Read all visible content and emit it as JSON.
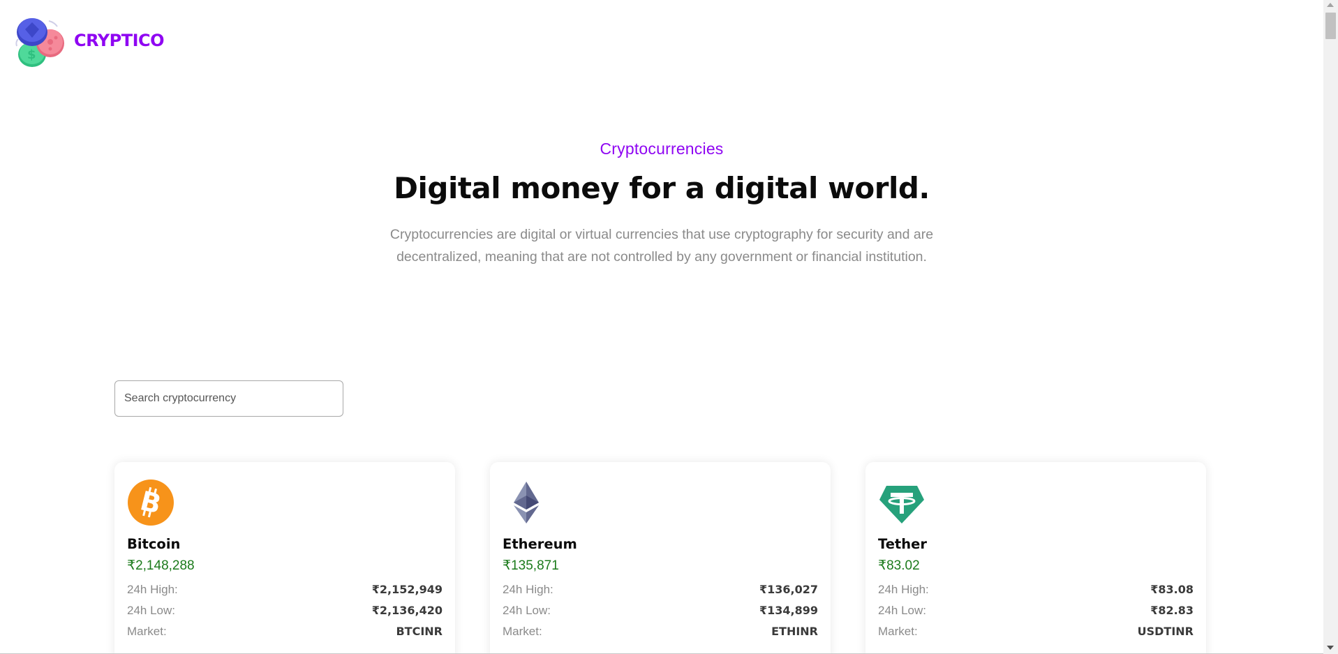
{
  "brand": {
    "name": "CRYPTICO",
    "color": "#8f06f2"
  },
  "hero": {
    "eyebrow": "Cryptocurrencies",
    "headline": "Digital money for a digital world.",
    "description": "Cryptocurrencies are digital or virtual currencies that use cryptography for security and are decentralized, meaning that are not controlled by any government or financial institution."
  },
  "search": {
    "placeholder": "Search cryptocurrency",
    "value": ""
  },
  "labels": {
    "high": "24h High:",
    "low": "24h Low:",
    "market": "Market:"
  },
  "cards": [
    {
      "name": "Bitcoin",
      "icon": "bitcoin-icon",
      "price": "₹2,148,288",
      "high": "₹2,152,949",
      "low": "₹2,136,420",
      "market": "BTCINR"
    },
    {
      "name": "Ethereum",
      "icon": "ethereum-icon",
      "price": "₹135,871",
      "high": "₹136,027",
      "low": "₹134,899",
      "market": "ETHINR"
    },
    {
      "name": "Tether",
      "icon": "tether-icon",
      "price": "₹83.02",
      "high": "₹83.08",
      "low": "₹82.83",
      "market": "USDTINR"
    }
  ],
  "colors": {
    "accent": "#8f06f2",
    "price": "#1b7a1b",
    "bitcoin": "#f7931a",
    "ethereum": "#62688f",
    "tether": "#26a17b"
  }
}
